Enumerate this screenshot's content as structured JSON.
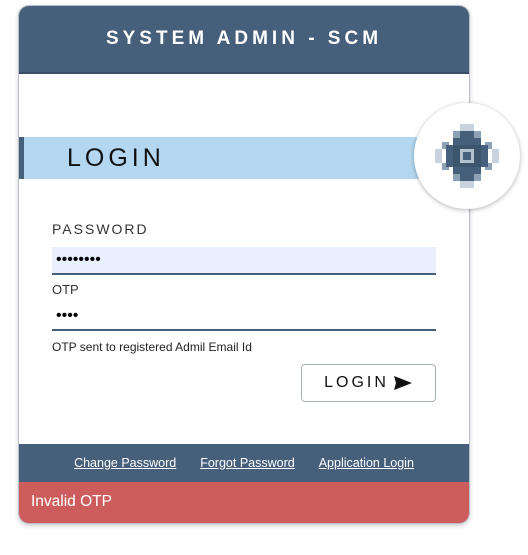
{
  "header": {
    "title": "SYSTEM ADMIN - SCM"
  },
  "banner": {
    "title": "LOGIN"
  },
  "form": {
    "password_label": "PASSWORD",
    "password_value": "••••••••",
    "otp_label": "OTP",
    "otp_value": "••••",
    "otp_note": "OTP sent to registered Admil Email Id",
    "login_button_label": "LOGIN"
  },
  "footer": {
    "links": [
      "Change Password",
      "Forgot Password",
      "Application Login"
    ]
  },
  "error": {
    "message": "Invalid OTP"
  },
  "icons": {
    "logo": "pixel-diamond-logo-icon",
    "login_button": "send-arrow-icon"
  },
  "colors": {
    "header": "#46607c",
    "banner": "#b3d7f0",
    "error": "#cd5c5c"
  }
}
